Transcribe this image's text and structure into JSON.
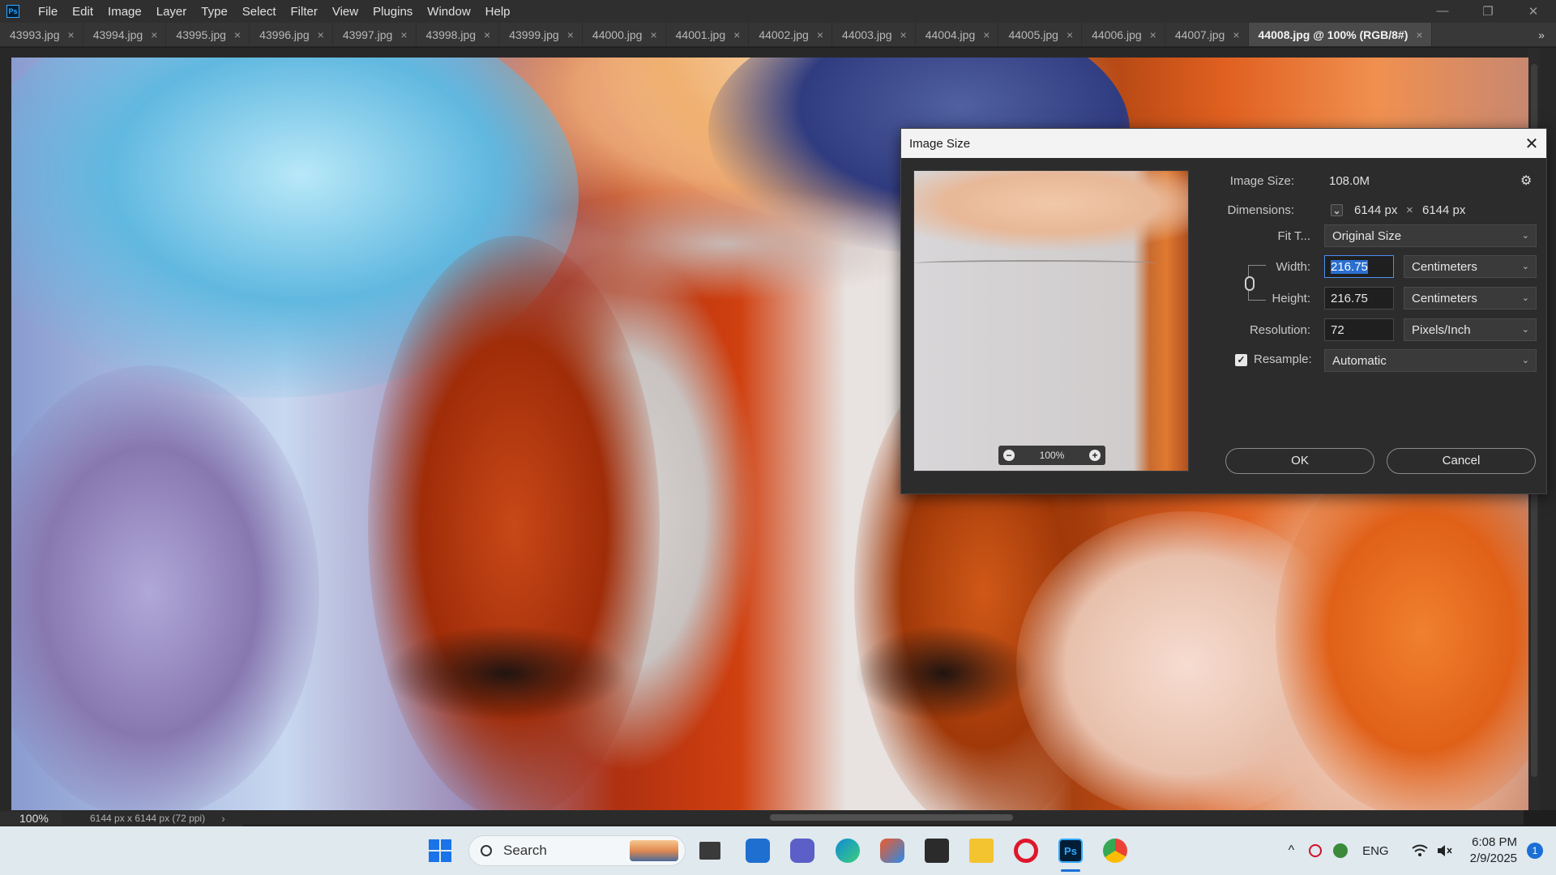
{
  "app": {
    "logo_text": "Ps",
    "menu": [
      "File",
      "Edit",
      "Image",
      "Layer",
      "Type",
      "Select",
      "Filter",
      "View",
      "Plugins",
      "Window",
      "Help"
    ]
  },
  "window_controls": {
    "minimize": "—",
    "restore": "❐",
    "close": "✕"
  },
  "tabs": [
    {
      "label": "43993.jpg",
      "active": false
    },
    {
      "label": "43994.jpg",
      "active": false
    },
    {
      "label": "43995.jpg",
      "active": false
    },
    {
      "label": "43996.jpg",
      "active": false
    },
    {
      "label": "43997.jpg",
      "active": false
    },
    {
      "label": "43998.jpg",
      "active": false
    },
    {
      "label": "43999.jpg",
      "active": false
    },
    {
      "label": "44000.jpg",
      "active": false
    },
    {
      "label": "44001.jpg",
      "active": false
    },
    {
      "label": "44002.jpg",
      "active": false
    },
    {
      "label": "44003.jpg",
      "active": false
    },
    {
      "label": "44004.jpg",
      "active": false
    },
    {
      "label": "44005.jpg",
      "active": false
    },
    {
      "label": "44006.jpg",
      "active": false
    },
    {
      "label": "44007.jpg",
      "active": false
    },
    {
      "label": "44008.jpg @ 100% (RGB/8#)",
      "active": true
    }
  ],
  "tab_close_glyph": "×",
  "tab_overflow_glyph": "»",
  "status": {
    "zoom": "100%",
    "info": "6144 px x 6144 px (72 ppi)",
    "arrow": "›"
  },
  "dialog": {
    "title": "Image Size",
    "close_glyph": "✕",
    "gear_glyph": "⚙",
    "image_size_label": "Image Size:",
    "image_size_value": "108.0M",
    "dimensions_label": "Dimensions:",
    "dimensions_width": "6144 px",
    "dimensions_times": "×",
    "dimensions_height": "6144 px",
    "fit_to_label": "Fit T...",
    "fit_to_value": "Original Size",
    "width_label": "Width:",
    "width_value": "216.75",
    "width_unit": "Centimeters",
    "height_label": "Height:",
    "height_value": "216.75",
    "height_unit": "Centimeters",
    "resolution_label": "Resolution:",
    "resolution_value": "72",
    "resolution_unit": "Pixels/Inch",
    "resample_label": "Resample:",
    "resample_checked": true,
    "resample_value": "Automatic",
    "preview_zoom": "100%",
    "zoom_out_glyph": "−",
    "zoom_in_glyph": "+",
    "ok_label": "OK",
    "cancel_label": "Cancel",
    "chevron_glyph": "⌄",
    "check_glyph": "✓"
  },
  "taskbar": {
    "search_placeholder": "Search",
    "language": "ENG",
    "time": "6:08 PM",
    "date": "2/9/2025",
    "notification_count": "1",
    "tray_up_glyph": "^"
  }
}
